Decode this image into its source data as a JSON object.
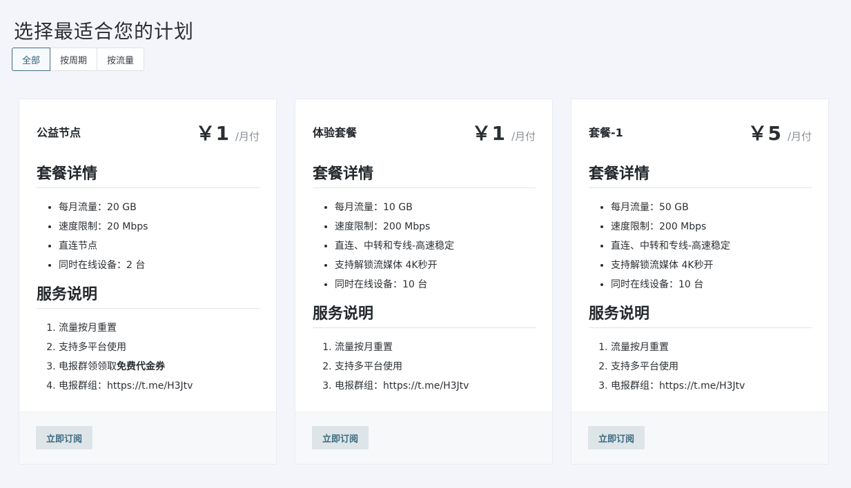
{
  "page": {
    "title": "选择最适合您的计划"
  },
  "tabs": [
    {
      "label": "全部",
      "active": true
    },
    {
      "label": "按周期",
      "active": false
    },
    {
      "label": "按流量",
      "active": false
    }
  ],
  "section_labels": {
    "details": "套餐详情",
    "service": "服务说明"
  },
  "subscribe_label": "立即订阅",
  "colors": {
    "accent": "#3e6b82",
    "button_bg": "#dde5e8",
    "page_bg": "#f4f5fa"
  },
  "plans": [
    {
      "name": "公益节点",
      "price": "￥1",
      "period": "/月付",
      "features": [
        "每月流量：20 GB",
        "速度限制：20 Mbps",
        "直连节点",
        "同时在线设备：2 台"
      ],
      "notes": [
        {
          "text": "流量按月重置",
          "bold": ""
        },
        {
          "text": "支持多平台使用",
          "bold": ""
        },
        {
          "text": "电报群领领取",
          "bold": "免费代金券"
        },
        {
          "text": "电报群组：https://t.me/H3Jtv",
          "bold": ""
        }
      ]
    },
    {
      "name": "体验套餐",
      "price": "￥1",
      "period": "/月付",
      "features": [
        "每月流量：10 GB",
        "速度限制：200 Mbps",
        "直连、中转和专线-高速稳定",
        "支持解锁流媒体 4K秒开",
        "同时在线设备：10 台"
      ],
      "notes": [
        {
          "text": "流量按月重置",
          "bold": ""
        },
        {
          "text": "支持多平台使用",
          "bold": ""
        },
        {
          "text": "电报群组：https://t.me/H3Jtv",
          "bold": ""
        }
      ]
    },
    {
      "name": "套餐-1",
      "price": "￥5",
      "period": "/月付",
      "features": [
        "每月流量：50 GB",
        "速度限制：200 Mbps",
        "直连、中转和专线-高速稳定",
        "支持解锁流媒体 4K秒开",
        "同时在线设备：10 台"
      ],
      "notes": [
        {
          "text": "流量按月重置",
          "bold": ""
        },
        {
          "text": "支持多平台使用",
          "bold": ""
        },
        {
          "text": "电报群组：https://t.me/H3Jtv",
          "bold": ""
        }
      ]
    }
  ]
}
